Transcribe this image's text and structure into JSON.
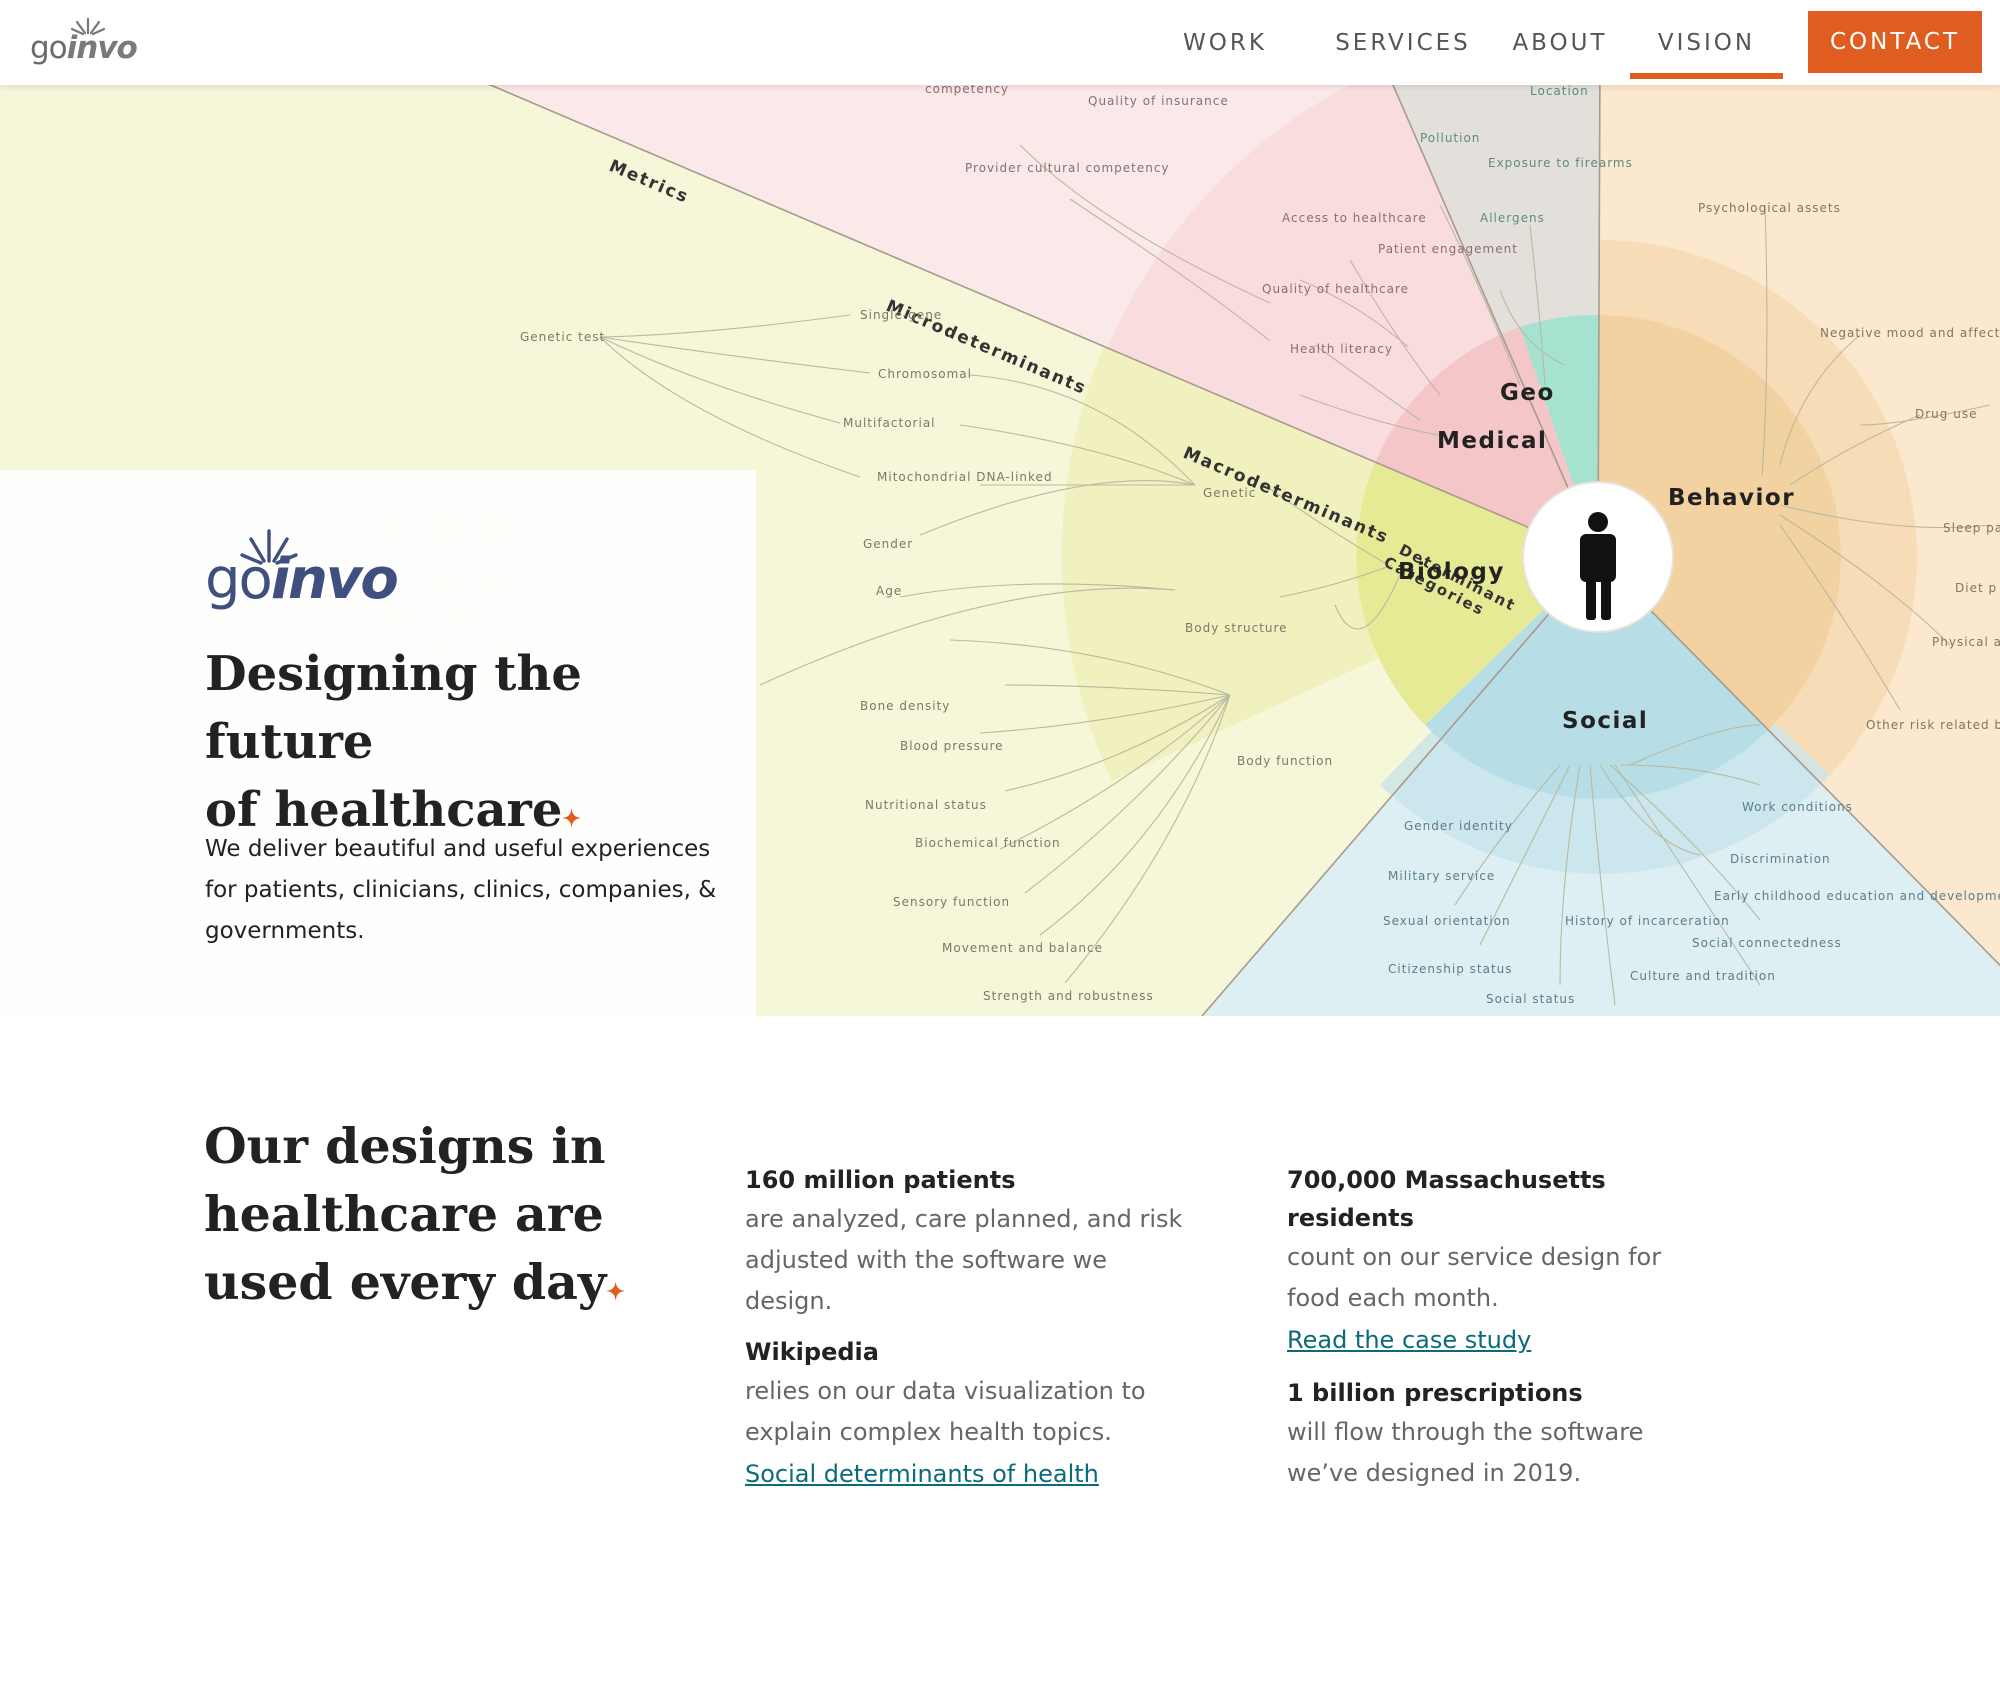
{
  "header": {
    "logo_go": "go",
    "logo_invo": "invo",
    "nav": [
      {
        "label": "WORK"
      },
      {
        "label": "SERVICES"
      },
      {
        "label": "ABOUT"
      },
      {
        "label": "VISION"
      }
    ],
    "active_nav": "VISION",
    "contact_label": "CONTACT",
    "accent_color": "#e05d22"
  },
  "hero": {
    "logo_go": "go",
    "logo_invo": "invo",
    "title_line1": "Designing the future",
    "title_line2": "of healthcare",
    "title_dot": "✦",
    "description": "We deliver beautiful and useful experiences for patients, clinicians, clinics, companies, & governments.",
    "infographic": {
      "rings": [
        "Metrics",
        "Microdeterminants",
        "Macrodeterminants",
        "Determinant Categories"
      ],
      "categories": [
        "Geo",
        "Medical",
        "Behavior",
        "Biology",
        "Social"
      ],
      "category_colors": {
        "Geo": "#8fdcc7",
        "Medical": "#f4b7bd",
        "Behavior": "#f6cf9a",
        "Biology": "#e9ea9a",
        "Social": "#a8d8e2"
      },
      "center_icon": "person-icon",
      "biology_macro": [
        "Genetic",
        "Body structure",
        "Body function"
      ],
      "biology_micro": [
        "Single-gene",
        "Chromosomal",
        "Multifactorial",
        "Mitochondrial DNA-linked",
        "Gender",
        "Age",
        "Bone density",
        "Blood pressure",
        "Nutritional status",
        "Biochemical function",
        "Sensory function",
        "Movement and balance",
        "Strength and robustness"
      ],
      "biology_metrics": [
        "Genetic test"
      ],
      "medical_items": [
        "competency",
        "Quality of insurance",
        "Provider cultural competency",
        "Access to healthcare",
        "Patient engagement",
        "Quality of healthcare",
        "Health literacy"
      ],
      "geo_items": [
        "Location",
        "Pollution",
        "Exposure to firearms",
        "Allergens"
      ],
      "behavior_items": [
        "Psychological assets",
        "Negative mood and affects",
        "Drug use",
        "Sleep pa",
        "Diet p",
        "Physical ac",
        "Other risk related behaviors"
      ],
      "social_items": [
        "Gender identity",
        "Military service",
        "Sexual orientation",
        "Citizenship status",
        "Social status",
        "History of incarceration",
        "Culture and tradition",
        "Work conditions",
        "Discrimination",
        "Early childhood education and development",
        "Social connectedness"
      ]
    }
  },
  "stats_section": {
    "title": "Our designs in healthcare are used every day",
    "title_dot": "✦",
    "items": [
      {
        "head": "160 million patients",
        "body": "are analyzed, care planned, and risk adjusted with the software we design.",
        "link": ""
      },
      {
        "head": "700,000 Massachusetts residents",
        "body": "count on our service design for food each month.",
        "link": "Read the case study"
      },
      {
        "head": "Wikipedia",
        "body": "relies on our data visualization to explain complex health topics.",
        "link": "Social determinants of health"
      },
      {
        "head": "1 billion prescriptions",
        "body": "will flow through the software we’ve designed in 2019.",
        "link": ""
      }
    ]
  }
}
